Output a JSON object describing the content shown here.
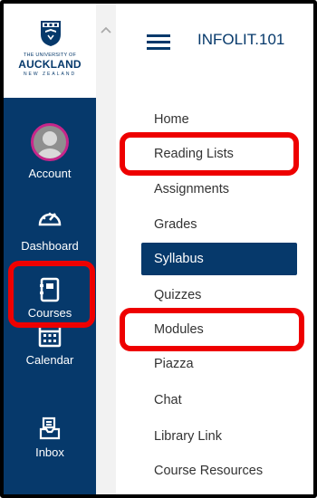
{
  "logo": {
    "line1": "THE UNIVERSITY OF",
    "line2": "AUCKLAND",
    "line3": "NEW ZEALAND"
  },
  "global_nav": {
    "account": "Account",
    "dashboard": "Dashboard",
    "courses": "Courses",
    "calendar": "Calendar",
    "inbox": "Inbox"
  },
  "header": {
    "course_code": "INFOLIT.101"
  },
  "course_nav": {
    "items": [
      "Home",
      "Reading Lists",
      "Assignments",
      "Grades",
      "Syllabus",
      "Quizzes",
      "Modules",
      "Piazza",
      "Chat",
      "Library Link",
      "Course Resources"
    ],
    "active": "Syllabus"
  },
  "colors": {
    "brand": "#06396b",
    "highlight": "#ee0000",
    "avatar_ring": "#c7268a"
  }
}
